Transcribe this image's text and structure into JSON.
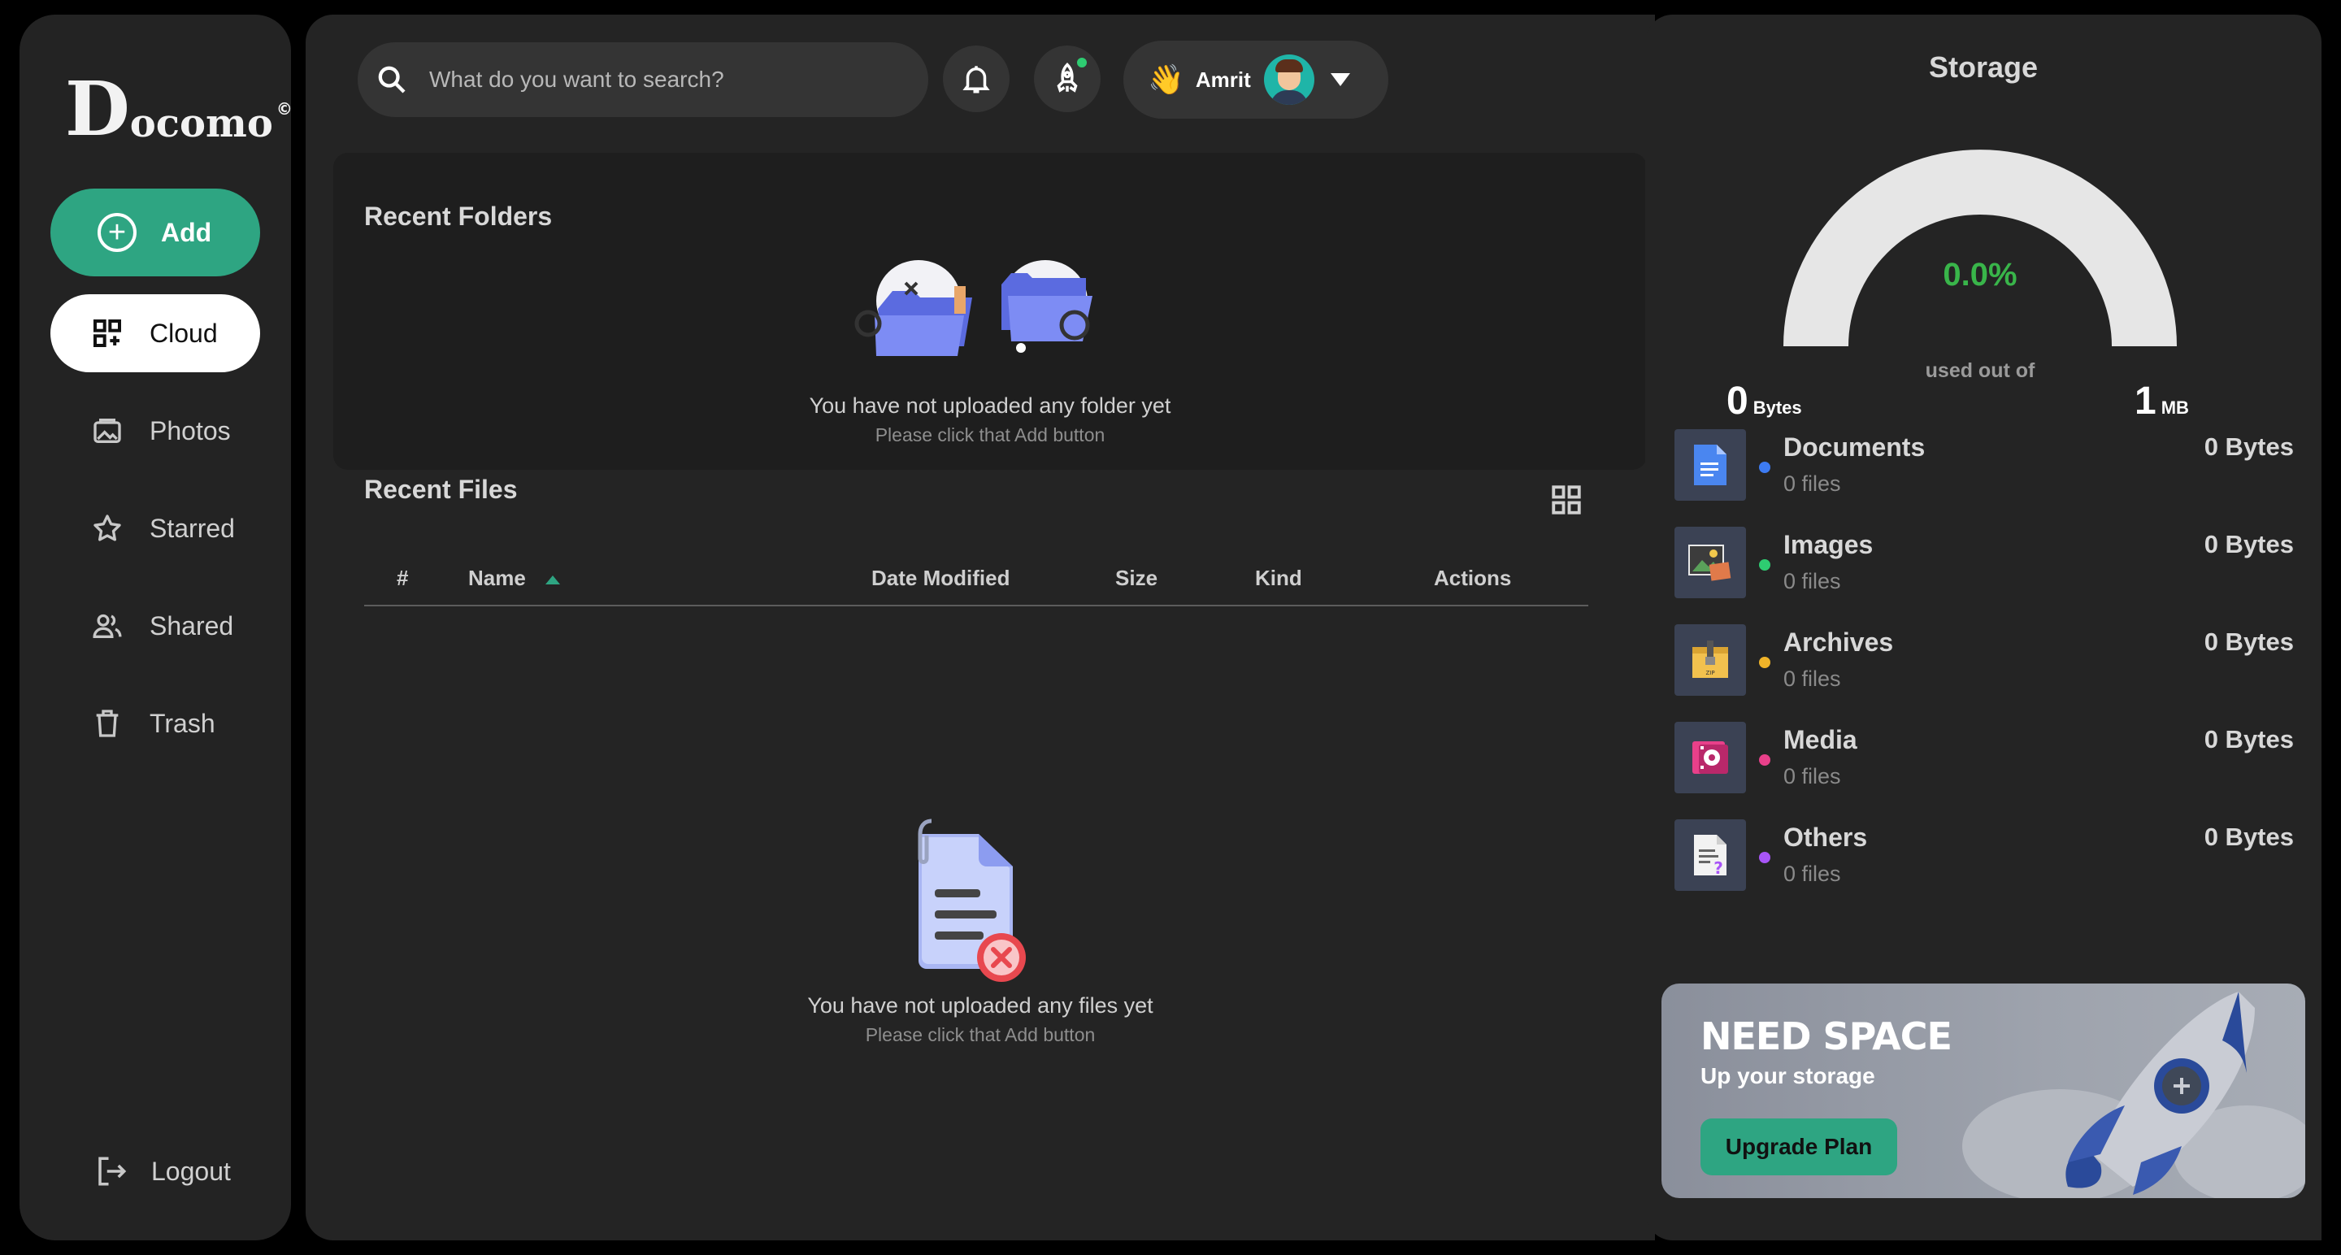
{
  "brand": {
    "logo_big": "D",
    "logo_rest": "ocomo",
    "logo_mark": "©"
  },
  "sidebar": {
    "add_label": "Add",
    "items": [
      {
        "label": "Cloud",
        "icon": "grid-plus-icon",
        "active": true
      },
      {
        "label": "Photos",
        "icon": "photo-icon",
        "active": false
      },
      {
        "label": "Starred",
        "icon": "star-icon",
        "active": false
      },
      {
        "label": "Shared",
        "icon": "users-icon",
        "active": false
      },
      {
        "label": "Trash",
        "icon": "trash-icon",
        "active": false
      }
    ],
    "logout_label": "Logout"
  },
  "header": {
    "search_placeholder": "What do you want to search?",
    "user_name": "Amrit",
    "wave": "👋"
  },
  "recent_folders": {
    "title": "Recent Folders",
    "empty_title": "You have not uploaded any folder yet",
    "empty_sub": "Please click that Add button"
  },
  "recent_files": {
    "title": "Recent Files",
    "columns": [
      "#",
      "Name",
      "Date Modified",
      "Size",
      "Kind",
      "Actions"
    ],
    "empty_title": "You have not uploaded any files yet",
    "empty_sub": "Please click that Add button"
  },
  "storage": {
    "title": "Storage",
    "percent_label": "0.0%",
    "used_fraction": 0.0,
    "used_out_of": "used out of",
    "min_value": "0",
    "min_unit": "Bytes",
    "max_value": "1",
    "max_unit": "MB",
    "categories": [
      {
        "name": "Documents",
        "files": "0 files",
        "size": "0 Bytes",
        "color": "#3d7bf2",
        "icon": "document-icon"
      },
      {
        "name": "Images",
        "files": "0 files",
        "size": "0 Bytes",
        "color": "#2ecc71",
        "icon": "image-icon"
      },
      {
        "name": "Archives",
        "files": "0 files",
        "size": "0 Bytes",
        "color": "#f0b429",
        "icon": "archive-icon"
      },
      {
        "name": "Media",
        "files": "0 files",
        "size": "0 Bytes",
        "color": "#e8408a",
        "icon": "media-icon"
      },
      {
        "name": "Others",
        "files": "0 files",
        "size": "0 Bytes",
        "color": "#a855f7",
        "icon": "other-file-icon"
      }
    ]
  },
  "promo": {
    "heading": "NEED SPACE",
    "sub": "Up your storage",
    "button": "Upgrade Plan"
  }
}
